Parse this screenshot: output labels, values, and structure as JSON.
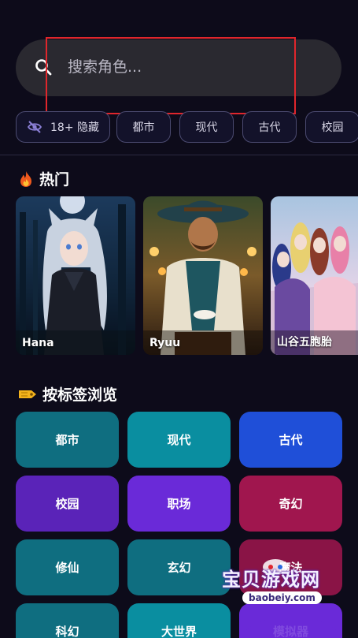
{
  "search": {
    "placeholder": "搜索角色..."
  },
  "filter_chips": [
    {
      "label": "18+ 隐藏",
      "icon": "eye-off-icon"
    },
    {
      "label": "都市"
    },
    {
      "label": "现代"
    },
    {
      "label": "古代"
    },
    {
      "label": "校园"
    }
  ],
  "hot": {
    "title": "热门",
    "icon": "fire-icon",
    "characters": [
      {
        "name": "Hana"
      },
      {
        "name": "Ryuu"
      },
      {
        "name": "山谷五胞胎"
      }
    ]
  },
  "browse": {
    "title": "按标签浏览",
    "icon": "tag-icon",
    "tags": [
      {
        "label": "都市",
        "color": "#0f6e80"
      },
      {
        "label": "现代",
        "color": "#0a8ea0"
      },
      {
        "label": "古代",
        "color": "#1f4fd8"
      },
      {
        "label": "校园",
        "color": "#5a23b8"
      },
      {
        "label": "职场",
        "color": "#6a2ad8"
      },
      {
        "label": "奇幻",
        "color": "#a0164e"
      },
      {
        "label": "修仙",
        "color": "#0f6e80"
      },
      {
        "label": "玄幻",
        "color": "#0f6e80"
      },
      {
        "label": "魔法",
        "color": "#a0164e"
      },
      {
        "label": "科幻",
        "color": "#0f6e80"
      },
      {
        "label": "大世界",
        "color": "#0a8ea0"
      },
      {
        "label": "模拟器",
        "color": "#6a2ad8"
      }
    ]
  },
  "watermark": {
    "title": "宝贝游戏网",
    "url": "baobeiy.com"
  }
}
